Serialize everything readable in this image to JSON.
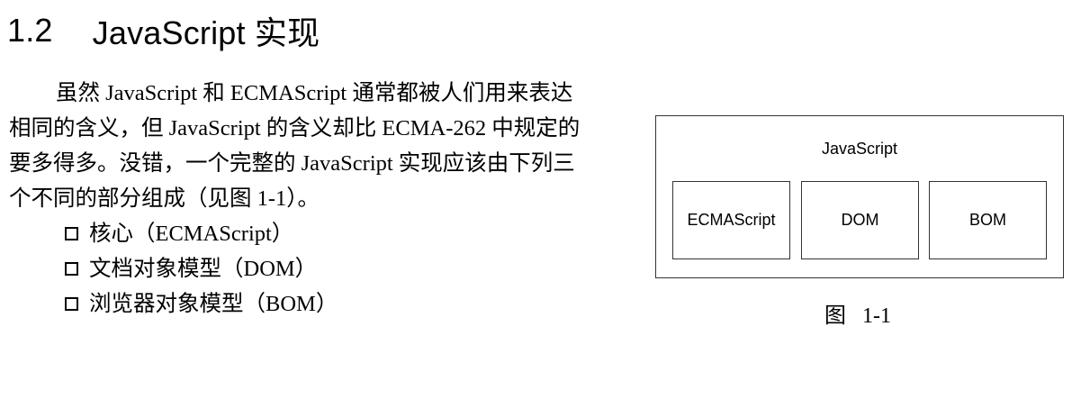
{
  "heading": {
    "number": "1.2",
    "title": "JavaScript 实现"
  },
  "paragraph": {
    "lines": [
      "虽然 JavaScript 和 ECMAScript 通常都被人们用来表达",
      "相同的含义，但 JavaScript 的含义却比 ECMA-262 中规定的",
      "要多得多。没错，一个完整的 JavaScript 实现应该由下列三",
      "个不同的部分组成（见图 1-1）。"
    ]
  },
  "list": {
    "items": [
      "核心（ECMAScript）",
      "文档对象模型（DOM）",
      "浏览器对象模型（BOM）"
    ]
  },
  "figure": {
    "outer_label": "JavaScript",
    "boxes": [
      "ECMAScript",
      "DOM",
      "BOM"
    ],
    "caption": "图   1-1"
  }
}
